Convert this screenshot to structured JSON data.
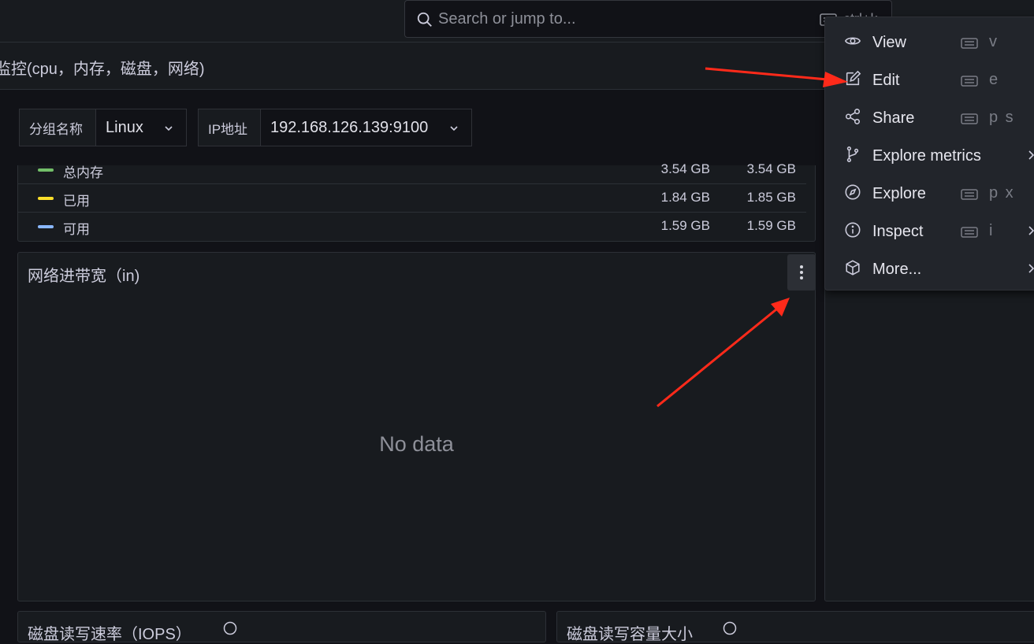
{
  "search": {
    "placeholder": "Search or jump to...",
    "shortcut_hint": "ctrl+k"
  },
  "breadcrumb": {
    "title": "监控(cpu，内存，磁盘，网络)"
  },
  "variables": [
    {
      "label": "分组名称",
      "value": "Linux"
    },
    {
      "label": "IP地址",
      "value": "192.168.126.139:9100"
    }
  ],
  "legend": {
    "rows": [
      {
        "name": "总内存",
        "color": "#73bf69",
        "v1": "3.54 GB",
        "v2": "3.54 GB"
      },
      {
        "name": "已用",
        "color": "#fade2a",
        "v1": "1.84 GB",
        "v2": "1.85 GB"
      },
      {
        "name": "可用",
        "color": "#8ab8ff",
        "v1": "1.59 GB",
        "v2": "1.59 GB"
      }
    ]
  },
  "network_panel": {
    "title": "网络进带宽（in)",
    "no_data": "No data",
    "menu_icon": "kebab-icon"
  },
  "bottom_panels": [
    {
      "title": "磁盘读写速率（IOPS）"
    },
    {
      "title": "磁盘读写容量大小"
    }
  ],
  "context_menu": {
    "items": [
      {
        "label": "View",
        "icon": "eye-icon",
        "shortcut": "v",
        "has_submenu": false
      },
      {
        "label": "Edit",
        "icon": "edit-icon",
        "shortcut": "e",
        "has_submenu": false
      },
      {
        "label": "Share",
        "icon": "share-icon",
        "shortcut": "p s",
        "has_submenu": false
      },
      {
        "label": "Explore metrics",
        "icon": "code-branch-icon",
        "shortcut": "",
        "has_submenu": true
      },
      {
        "label": "Explore",
        "icon": "compass-icon",
        "shortcut": "p x",
        "has_submenu": false
      },
      {
        "label": "Inspect",
        "icon": "info-circle-icon",
        "shortcut": "i",
        "has_submenu": true
      },
      {
        "label": "More...",
        "icon": "cube-icon",
        "shortcut": "",
        "has_submenu": true
      }
    ]
  },
  "colors": {
    "background": "#111217",
    "panel": "#181b1f",
    "menu": "#22252b",
    "annotation": "#ff2a1a"
  }
}
